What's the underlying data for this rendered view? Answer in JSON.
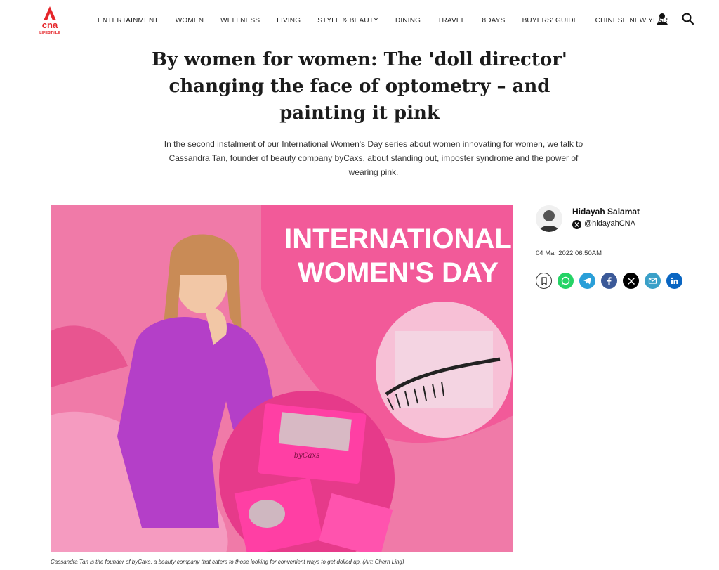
{
  "header": {
    "logo_text": "cna",
    "logo_sub": "LIFESTYLE",
    "nav": [
      "ENTERTAINMENT",
      "WOMEN",
      "WELLNESS",
      "LIVING",
      "STYLE & BEAUTY",
      "DINING",
      "TRAVEL",
      "8DAYS",
      "BUYERS' GUIDE",
      "CHINESE NEW YEAR"
    ],
    "icons": [
      "user-icon",
      "search-icon"
    ]
  },
  "article": {
    "headline": "By women for women: The 'doll director' changing the face of optometry – and painting it pink",
    "standfirst": "In the second instalment of our International Women's Day series about women innovating for women, we talk to Cassandra Tan, founder of beauty company byCaxs, about standing out, imposter syndrome and the power of wearing pink.",
    "hero": {
      "title_line1": "INTERNATIONAL",
      "title_line2": "WOMEN'S DAY",
      "box_brand": "byCaxs"
    },
    "caption": "Cassandra Tan is the founder of byCaxs, a beauty company that caters to those looking for convenient ways to get dolled up. (Art: Chern Ling)"
  },
  "author": {
    "name": "Hidayah Salamat",
    "handle": "@hidayahCNA",
    "date": "04 Mar 2022 06:50AM"
  },
  "share": [
    {
      "name": "bookmark",
      "icon": "bookmark-icon",
      "color": "#ffffff"
    },
    {
      "name": "whatsapp",
      "icon": "whatsapp-icon",
      "color": "#25d366"
    },
    {
      "name": "telegram",
      "icon": "telegram-icon",
      "color": "#2a9fd8"
    },
    {
      "name": "facebook",
      "icon": "facebook-icon",
      "color": "#3b5998"
    },
    {
      "name": "x",
      "icon": "x-icon",
      "color": "#000000"
    },
    {
      "name": "email",
      "icon": "email-icon",
      "color": "#3aa0c8"
    },
    {
      "name": "linkedin",
      "icon": "linkedin-icon",
      "color": "#0a66c2"
    }
  ],
  "colors": {
    "brand_red": "#e5252a",
    "hero_pink": "#f06aa0"
  }
}
